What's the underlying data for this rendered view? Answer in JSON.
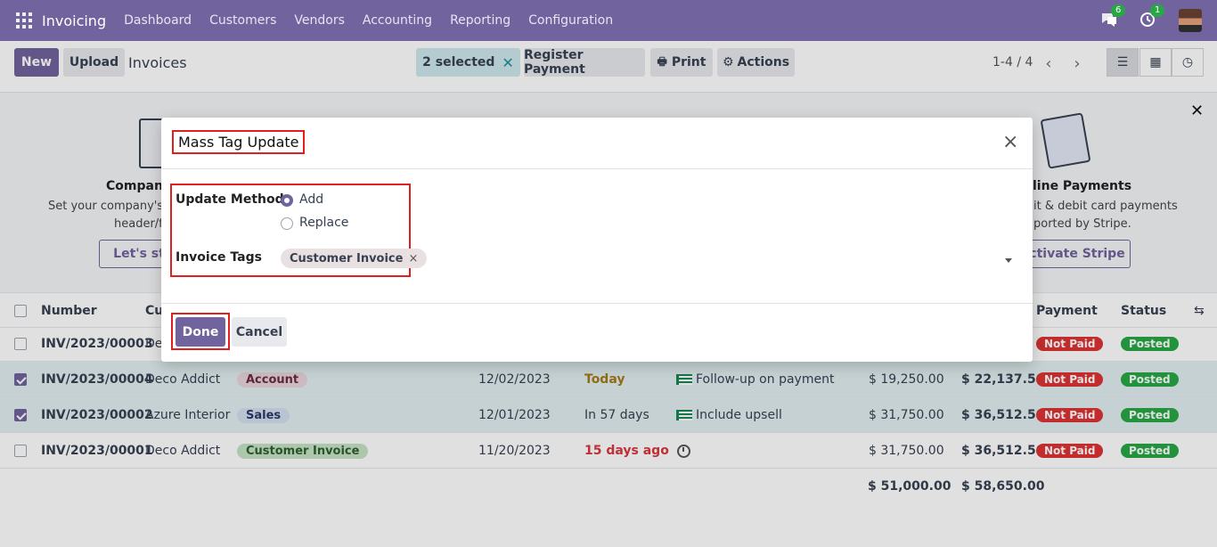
{
  "nav": {
    "app_name": "Invoicing",
    "menu": [
      "Dashboard",
      "Customers",
      "Vendors",
      "Accounting",
      "Reporting",
      "Configuration"
    ],
    "messages_count": "6",
    "activities_count": "1"
  },
  "control": {
    "new_label": "New",
    "upload_label": "Upload",
    "title": "Invoices",
    "selected_label": "2 selected",
    "register_payment_label": "Register Payment",
    "print_label": "Print",
    "actions_label": "Actions",
    "pager": "1-4 / 4"
  },
  "banner": {
    "left_title": "Company",
    "left_text1": "Set your company's da",
    "left_text2": "header/fo",
    "left_button": "Let's st",
    "right_title": "line Payments",
    "right_text1": "it & debit card payments",
    "right_text2": "ported by Stripe.",
    "right_button": "ctivate Stripe"
  },
  "table": {
    "headers": {
      "number": "Number",
      "customer": "Cu",
      "payment": "Payment",
      "status": "Status"
    },
    "rows": [
      {
        "number": "INV/2023/00003",
        "customer": "De",
        "tag": "",
        "date": "",
        "due": "",
        "activity": "",
        "untaxed": "",
        "total": "",
        "payment": "Not Paid",
        "status": "Posted",
        "selected": false
      },
      {
        "number": "INV/2023/00004",
        "customer": "Deco Addict",
        "tag": "Account",
        "date": "12/02/2023",
        "due": "Today",
        "activity": "Follow-up on payment",
        "untaxed": "$ 19,250.00",
        "total": "$ 22,137.50",
        "payment": "Not Paid",
        "status": "Posted",
        "selected": true
      },
      {
        "number": "INV/2023/00002",
        "customer": "Azure Interior",
        "tag": "Sales",
        "date": "12/01/2023",
        "due": "In 57 days",
        "activity": "Include upsell",
        "untaxed": "$ 31,750.00",
        "total": "$ 36,512.50",
        "payment": "Not Paid",
        "status": "Posted",
        "selected": true
      },
      {
        "number": "INV/2023/00001",
        "customer": "Deco Addict",
        "tag": "Customer Invoice",
        "date": "11/20/2023",
        "due": "15 days ago",
        "activity": "",
        "untaxed": "$ 31,750.00",
        "total": "$ 36,512.50",
        "payment": "Not Paid",
        "status": "Posted",
        "selected": false
      }
    ],
    "sum_untaxed": "$ 51,000.00",
    "sum_total": "$ 58,650.00"
  },
  "modal": {
    "title": "Mass Tag Update",
    "update_method_label": "Update Method",
    "option_add": "Add",
    "option_replace": "Replace",
    "invoice_tags_label": "Invoice Tags",
    "tag": "Customer Invoice",
    "tag_remove": "×",
    "done_label": "Done",
    "cancel_label": "Cancel",
    "close_glyph": "×"
  }
}
